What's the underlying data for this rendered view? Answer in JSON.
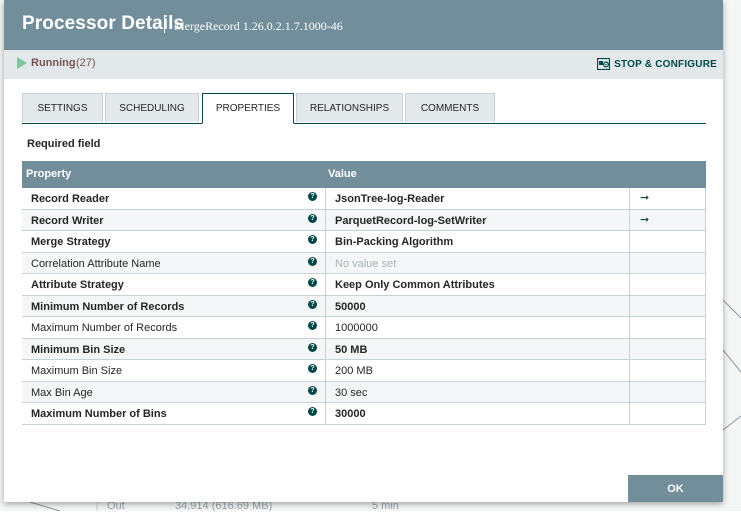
{
  "background": {
    "row_label": "Out",
    "row_value": "34,914 (616.69 MB)",
    "row_time": "5 min"
  },
  "dialog": {
    "title": "Processor Details",
    "subtitle": "MergeRecord 1.26.0.2.1.7.1000-46"
  },
  "status": {
    "state": "Running",
    "count": "(27)",
    "state_color": "#7dc7a0",
    "stop_configure_label": "STOP & CONFIGURE"
  },
  "tabs": [
    {
      "label": "SETTINGS"
    },
    {
      "label": "SCHEDULING"
    },
    {
      "label": "PROPERTIES",
      "active": true
    },
    {
      "label": "RELATIONSHIPS"
    },
    {
      "label": "COMMENTS"
    }
  ],
  "required_label": "Required field",
  "table": {
    "headers": {
      "property": "Property",
      "value": "Value"
    },
    "rows": [
      {
        "property": "Record Reader",
        "value": "JsonTree-log-Reader",
        "required": true,
        "has_link": true
      },
      {
        "property": "Record Writer",
        "value": "ParquetRecord-log-SetWriter",
        "required": true,
        "has_link": true
      },
      {
        "property": "Merge Strategy",
        "value": "Bin-Packing Algorithm",
        "required": true
      },
      {
        "property": "Correlation Attribute Name",
        "value": "No value set",
        "required": false,
        "unset": true
      },
      {
        "property": "Attribute Strategy",
        "value": "Keep Only Common Attributes",
        "required": true
      },
      {
        "property": "Minimum Number of Records",
        "value": "50000",
        "required": true
      },
      {
        "property": "Maximum Number of Records",
        "value": "1000000",
        "required": false
      },
      {
        "property": "Minimum Bin Size",
        "value": "50 MB",
        "required": true
      },
      {
        "property": "Maximum Bin Size",
        "value": "200 MB",
        "required": false
      },
      {
        "property": "Max Bin Age",
        "value": "30 sec",
        "required": false
      },
      {
        "property": "Maximum Number of Bins",
        "value": "30000",
        "required": true
      }
    ]
  },
  "footer": {
    "ok_label": "OK"
  },
  "colors": {
    "header": "#728e9b",
    "accent": "#004849",
    "status_bar": "#e3e8eb"
  }
}
